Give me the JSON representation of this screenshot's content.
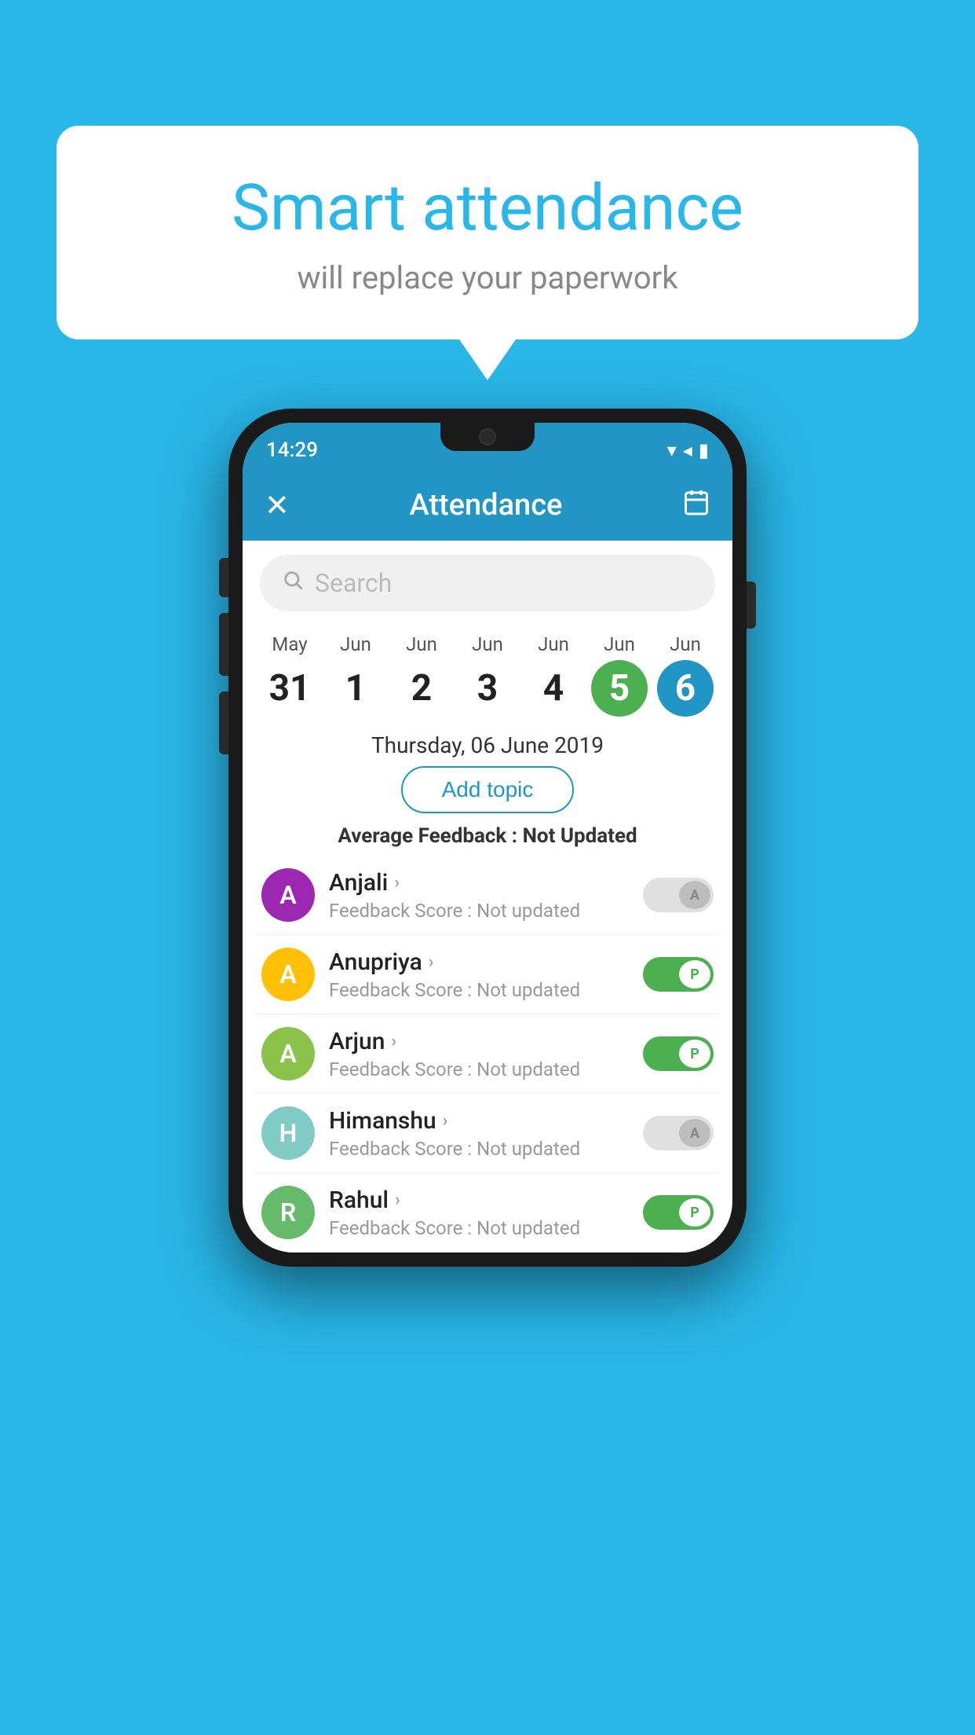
{
  "background_color": "#29b6e8",
  "speech_bubble": {
    "title": "Smart attendance",
    "subtitle": "will replace your paperwork"
  },
  "phone": {
    "status_bar": {
      "time": "14:29",
      "wifi": "▼",
      "signal": "▲",
      "battery": "▮"
    },
    "header": {
      "close_label": "×",
      "title": "Attendance",
      "calendar_icon": "calendar"
    },
    "search": {
      "placeholder": "Search"
    },
    "date_strip": {
      "dates": [
        {
          "month": "May",
          "day": "31",
          "selected": false
        },
        {
          "month": "Jun",
          "day": "1",
          "selected": false
        },
        {
          "month": "Jun",
          "day": "2",
          "selected": false
        },
        {
          "month": "Jun",
          "day": "3",
          "selected": false
        },
        {
          "month": "Jun",
          "day": "4",
          "selected": false
        },
        {
          "month": "Jun",
          "day": "5",
          "selected": "green"
        },
        {
          "month": "Jun",
          "day": "6",
          "selected": "blue"
        }
      ]
    },
    "selected_date_label": "Thursday, 06 June 2019",
    "add_topic_label": "Add topic",
    "avg_feedback_label": "Average Feedback : ",
    "avg_feedback_value": "Not Updated",
    "students": [
      {
        "name": "Anjali",
        "avatar_letter": "A",
        "avatar_color": "purple",
        "feedback_label": "Feedback Score : Not updated",
        "toggle": "off",
        "toggle_letter": "A"
      },
      {
        "name": "Anupriya",
        "avatar_letter": "A",
        "avatar_color": "yellow",
        "feedback_label": "Feedback Score : Not updated",
        "toggle": "on",
        "toggle_letter": "P"
      },
      {
        "name": "Arjun",
        "avatar_letter": "A",
        "avatar_color": "lightgreen",
        "feedback_label": "Feedback Score : Not updated",
        "toggle": "on",
        "toggle_letter": "P"
      },
      {
        "name": "Himanshu",
        "avatar_letter": "H",
        "avatar_color": "teal",
        "feedback_label": "Feedback Score : Not updated",
        "toggle": "off",
        "toggle_letter": "A"
      },
      {
        "name": "Rahul",
        "avatar_letter": "R",
        "avatar_color": "green2",
        "feedback_label": "Feedback Score : Not updated",
        "toggle": "on",
        "toggle_letter": "P"
      }
    ]
  }
}
